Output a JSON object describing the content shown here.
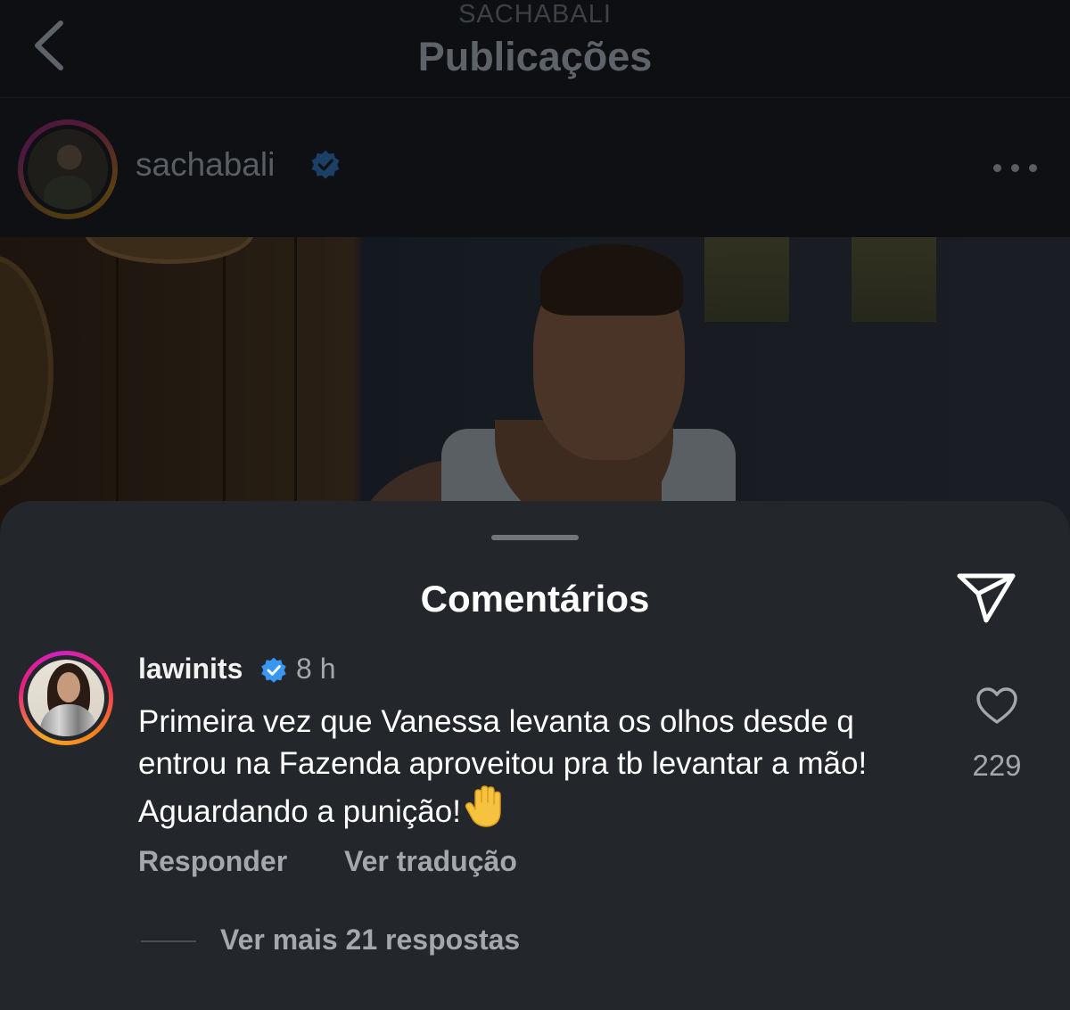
{
  "header": {
    "account_name": "SACHABALI",
    "title": "Publicações",
    "back_icon": "chevron-left-icon"
  },
  "post": {
    "username": "sachabali",
    "verified": true,
    "more_icon": "more-horizontal-icon"
  },
  "comments_sheet": {
    "title": "Comentários",
    "share_icon": "paper-plane-icon",
    "comment": {
      "username": "lawinits",
      "verified": true,
      "time": "8 h",
      "text": "Primeira vez que Vanessa levanta os olhos desde q entrou na Fazenda aproveitou pra tb levantar a mão! Aguardando a punição!",
      "emoji": "raised-hand-icon",
      "likes": "229",
      "reply_label": "Responder",
      "translate_label": "Ver tradução",
      "view_replies_label": "Ver mais 21 respostas"
    }
  },
  "colors": {
    "sheet_bg": "#23262b",
    "verified_blue": "#3897f0",
    "muted_text": "#a4a8ad"
  }
}
